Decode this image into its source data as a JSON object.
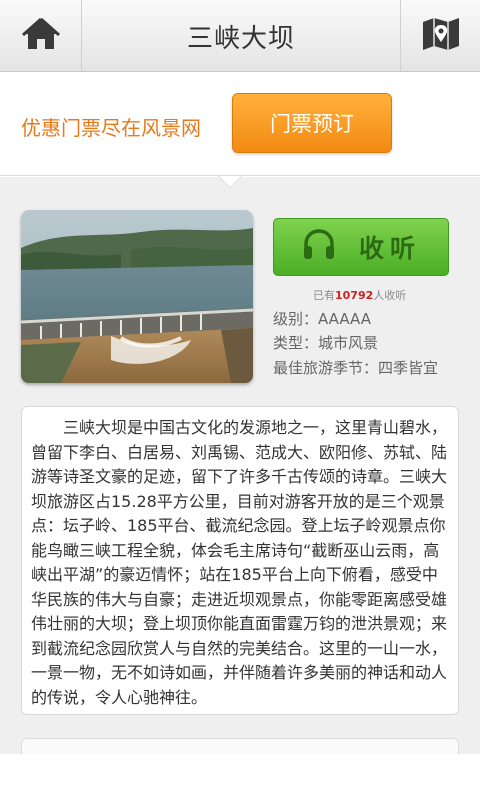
{
  "header": {
    "title": "三峡大坝",
    "home_icon": "home-icon",
    "map_icon": "map-pin-icon"
  },
  "promo": {
    "text": "优惠门票尽在风景网",
    "ticket_button": "门票预订"
  },
  "audio": {
    "listen_label": "收听",
    "count_prefix": "已有",
    "count": "10792",
    "count_suffix": "人收听"
  },
  "info": {
    "level": "级别：AAAAA",
    "type": "类型：城市风景",
    "season": "最佳旅游季节：四季皆宜"
  },
  "description": "三峡大坝是中国古文化的发源地之一，这里青山碧水，曾留下李白、白居易、刘禹锡、范成大、欧阳修、苏轼、陆游等诗圣文豪的足迹，留下了许多千古传颂的诗章。三峡大坝旅游区占15.28平方公里，目前对游客开放的是三个观景点：坛子岭、185平台、截流纪念园。登上坛子岭观景点你能鸟瞰三峡工程全貌，体会毛主席诗句“截断巫山云雨，高峡出平湖”的豪迈情怀；站在185平台上向下俯看，感受中华民族的伟大与自豪；走进近坝观景点，你能零距离感受雄伟壮丽的大坝；登上坝顶你能直面雷霆万钧的泄洪景观；来到截流纪念园欣赏人与自然的完美结合。这里的一山一水，一景一物，无不如诗如画，并伴随着许多美丽的神话和动人的传说，令人心驰神往。",
  "colors": {
    "accent_orange": "#f28a12",
    "listen_green": "#4cae26",
    "count_red": "#d02020"
  }
}
